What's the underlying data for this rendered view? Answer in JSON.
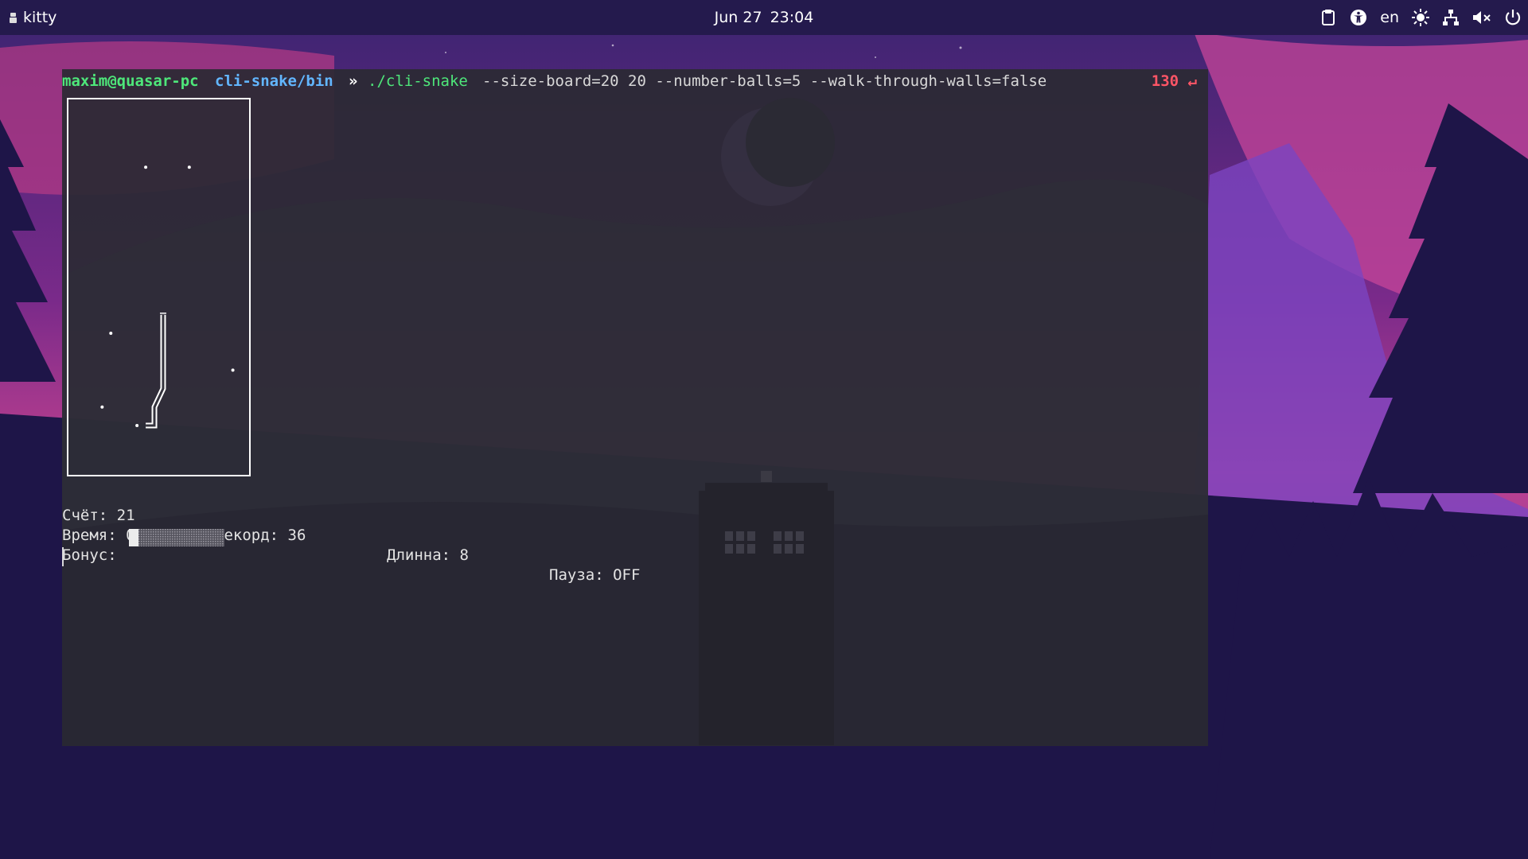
{
  "topbar": {
    "app_name": "kitty",
    "date": "Jun 27",
    "time": "23:04",
    "keyboard_layout": "en",
    "tray_icons": [
      "clipboard-icon",
      "accessibility-icon",
      "keyboard-layout",
      "brightness-icon",
      "network-icon",
      "volume-muted-icon",
      "power-icon"
    ]
  },
  "terminal": {
    "prompt": {
      "user_host": "maxim@quasar-pc",
      "cwd": "cli-snake/bin",
      "arrow": "»",
      "executable": "./cli-snake",
      "args": "--size-board=20 20 --number-balls=5 --walk-through-walls=false",
      "exit_code": "130 ↵"
    },
    "game": {
      "board_size": [
        20,
        20
      ],
      "snake_cells": [
        [
          10,
          11
        ],
        [
          10,
          12
        ],
        [
          10,
          13
        ],
        [
          10,
          14
        ],
        [
          10,
          15
        ],
        [
          9,
          16
        ],
        [
          9,
          17
        ],
        [
          8,
          17
        ]
      ],
      "balls": [
        [
          8,
          3
        ],
        [
          13,
          3
        ],
        [
          4,
          12
        ],
        [
          18,
          14
        ],
        [
          3,
          16
        ],
        [
          7,
          17
        ]
      ],
      "stats": {
        "score_label": "Счёт: 21",
        "record_label": "Рекорд: 36",
        "length_label": "Длинна: 8",
        "pause_label": "Пауза: OFF",
        "time_label": "Время: 00:00:15",
        "bonus_label": "Бонус:"
      },
      "bonus_fraction": 0.1
    }
  },
  "colors": {
    "prompt_user": "#4ee77a",
    "prompt_dir": "#62b6ff",
    "exit_code": "#ff5566",
    "terminal_bg": "#2b2a34",
    "topbar_bg": "#241a4d"
  }
}
